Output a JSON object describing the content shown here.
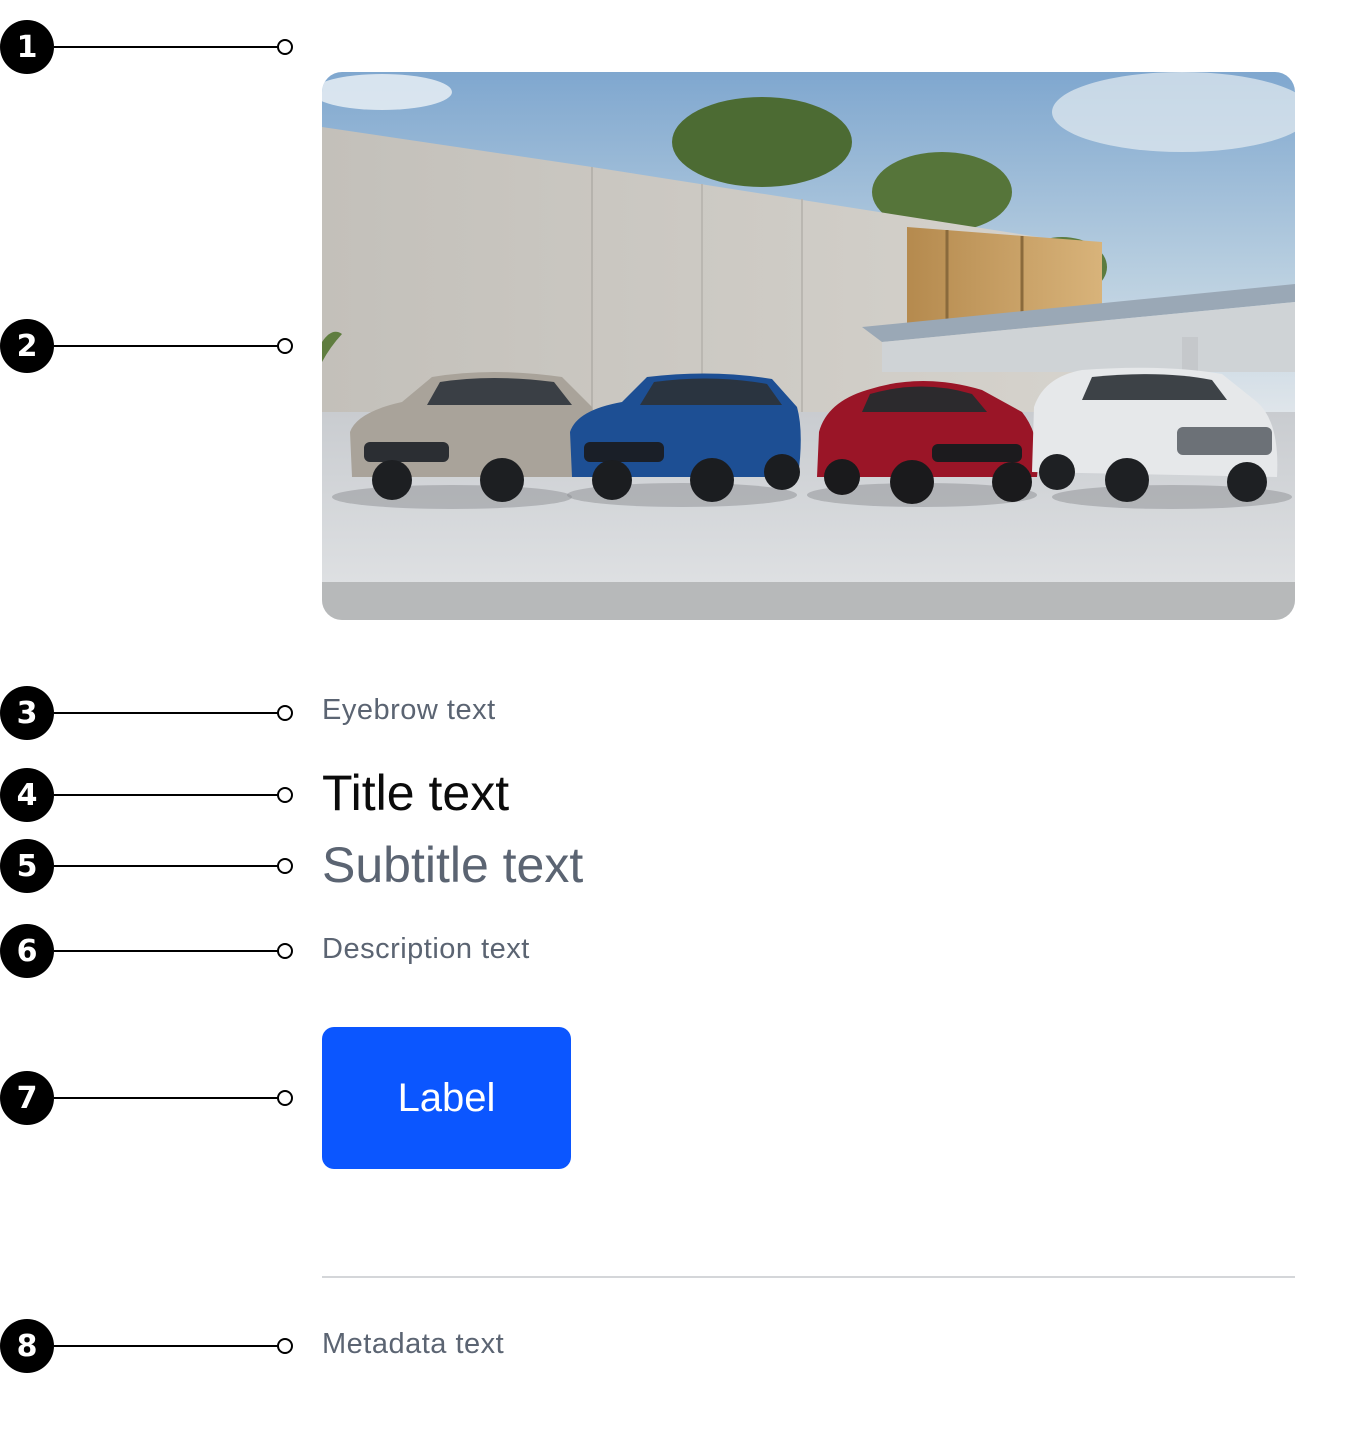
{
  "markers": [
    "1",
    "2",
    "3",
    "4",
    "5",
    "6",
    "7",
    "8"
  ],
  "card": {
    "eyebrow": "Eyebrow text",
    "title": "Title text",
    "subtitle": "Subtitle text",
    "description": "Description text",
    "button_label": "Label",
    "metadata": "Metadata text"
  },
  "colors": {
    "button": "#0b56ff",
    "muted_text": "#5b6472",
    "title_text": "#0b0b0b",
    "divider": "#d4d6d9",
    "marker": "#000000"
  },
  "image": {
    "subject": "four SUVs parked in front of a modern concrete building",
    "car_colors": [
      "#a9a39a",
      "#1d4f94",
      "#9a1527",
      "#e6e8ea"
    ]
  }
}
